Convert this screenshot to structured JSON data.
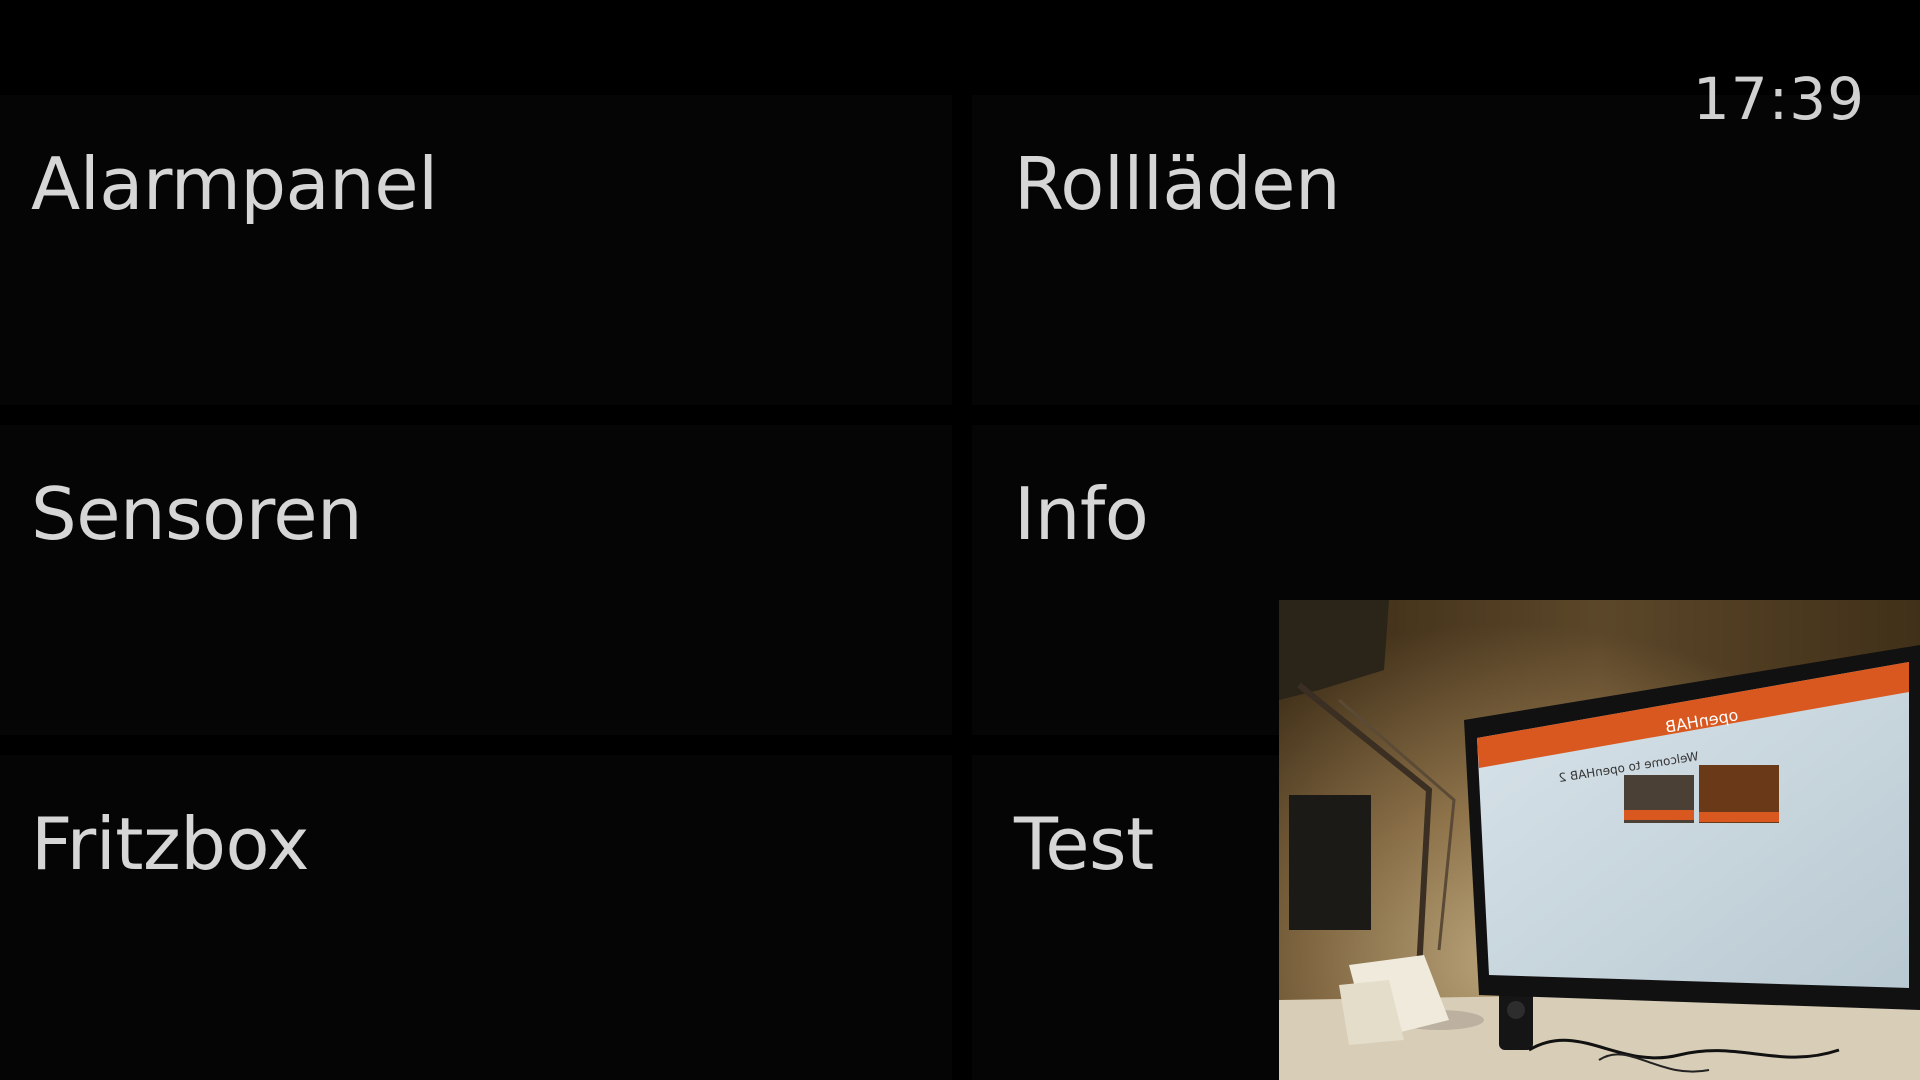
{
  "header": {
    "clock_text": "17:39"
  },
  "tiles": [
    {
      "label": "Alarmpanel"
    },
    {
      "label": "Rollläden"
    },
    {
      "label": "Sensoren"
    },
    {
      "label": "Info"
    },
    {
      "label": "Fritzbox"
    },
    {
      "label": "Test"
    }
  ],
  "camera": {
    "screen_brand": "openHAB",
    "screen_heading": "Welcome to openHAB 2"
  },
  "colors": {
    "background": "#000000",
    "tile_background": "#050505",
    "label_text": "#d6d6d6",
    "accent_orange": "#d9581f"
  }
}
